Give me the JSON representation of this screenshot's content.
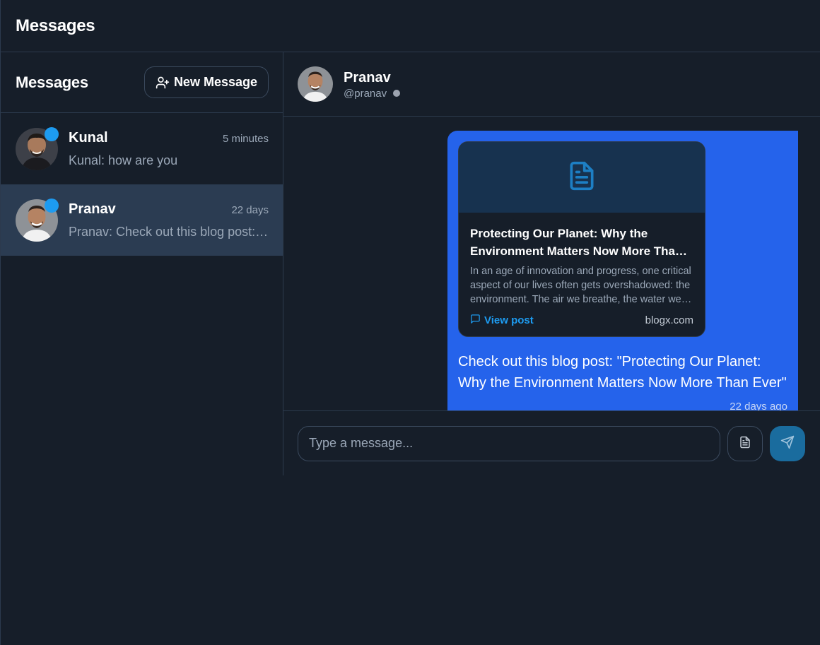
{
  "app": {
    "title": "Messages"
  },
  "sidebar": {
    "title": "Messages",
    "new_message_label": "New Message",
    "conversations": [
      {
        "name": "Kunal",
        "time": "5 minutes",
        "preview": "Kunal: how are you",
        "online": true,
        "active": false
      },
      {
        "name": "Pranav",
        "time": "22 days",
        "preview": "Pranav: Check out this blog post: \"Protecting Our Planet: Why the Environment Matters Now More Than Ever\"",
        "online": true,
        "active": true
      }
    ]
  },
  "chat": {
    "name": "Pranav",
    "handle": "@pranav",
    "messages": [
      {
        "link_card": {
          "title": "Protecting Our Planet: Why the Environment Matters Now More Than Ever",
          "description": "In an age of innovation and progress, one critical aspect of our lives often gets overshadowed: the environment. The air we breathe, the water we drink",
          "view_label": "View post",
          "domain": "blogx.com"
        },
        "text": "Check out this blog post: \"Protecting Our Planet: Why the Environment Matters Now More Than Ever\"",
        "time": "22 days ago"
      }
    ],
    "composer": {
      "placeholder": "Type a message..."
    }
  },
  "colors": {
    "background": "#161e29",
    "accent": "#1d9bf0",
    "bubble": "#2563eb",
    "active_row": "#2b3c52",
    "send_button": "#1a6c9e"
  },
  "icons": {
    "new_message": "user-plus-icon",
    "link_card": "document-icon",
    "view_post": "message-square-icon",
    "attach": "file-text-icon",
    "send": "send-icon"
  }
}
